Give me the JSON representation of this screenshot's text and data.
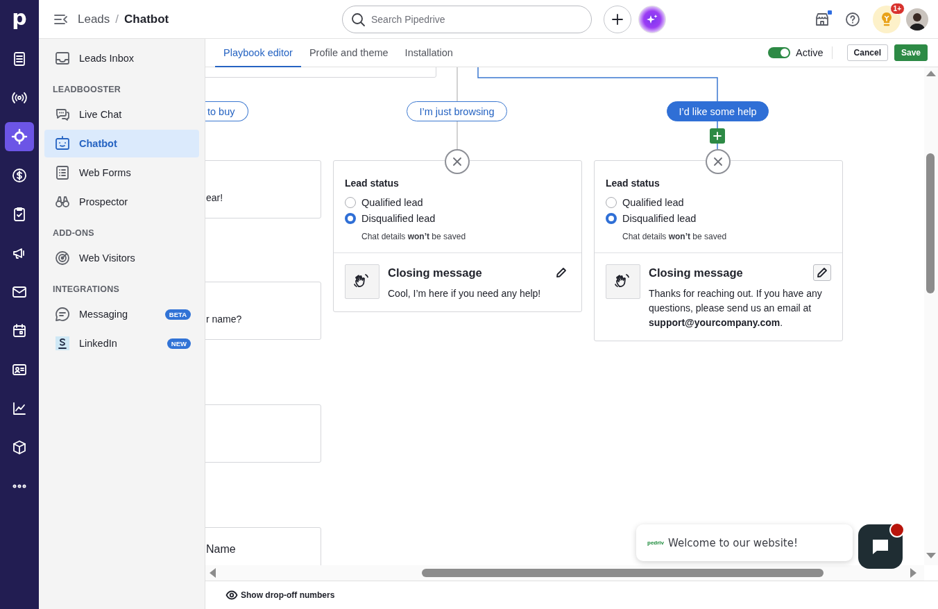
{
  "rail": {
    "logo": "p",
    "items": [
      {
        "selected": false
      },
      {
        "selected": false
      },
      {
        "selected": true
      },
      {
        "selected": false
      },
      {
        "selected": false
      },
      {
        "selected": false
      },
      {
        "selected": false
      },
      {
        "selected": false
      },
      {
        "selected": false
      },
      {
        "selected": false
      },
      {
        "selected": false
      },
      {
        "selected": false
      }
    ]
  },
  "header": {
    "breadcrumb_parent": "Leads",
    "separator": "/",
    "breadcrumb_current": "Chatbot",
    "search": {
      "placeholder": "Search Pipedrive"
    },
    "marketplace_dot": true,
    "tips_badge": "1+"
  },
  "sidebar": {
    "sections": [
      {
        "items": [
          {
            "label": "Leads Inbox",
            "selected": false
          }
        ]
      },
      {
        "heading": "LEADBOOSTER",
        "items": [
          {
            "label": "Live Chat",
            "selected": false
          },
          {
            "label": "Chatbot",
            "selected": true
          },
          {
            "label": "Web Forms",
            "selected": false
          },
          {
            "label": "Prospector",
            "selected": false
          }
        ]
      },
      {
        "heading": "ADD-ONS",
        "items": [
          {
            "label": "Web Visitors",
            "selected": false
          }
        ]
      },
      {
        "heading": "INTEGRATIONS",
        "items": [
          {
            "label": "Messaging",
            "selected": false,
            "badge": "BETA"
          },
          {
            "label": "LinkedIn",
            "selected": false,
            "badge": "NEW"
          }
        ]
      }
    ]
  },
  "tabs": [
    {
      "label": "Playbook editor",
      "selected": true
    },
    {
      "label": "Profile and theme",
      "selected": false
    },
    {
      "label": "Installation",
      "selected": false
    }
  ],
  "status_toggle": {
    "label": "Active",
    "on": true
  },
  "buttons": [
    {
      "label": "Cancel",
      "kind": "secondary"
    },
    {
      "label": "Save",
      "kind": "primary"
    }
  ],
  "canvas": {
    "answers": [
      {
        "label": "to buy",
        "selected": false
      },
      {
        "label": "I’m just browsing",
        "selected": false
      },
      {
        "label": "I’d like some help",
        "selected": true
      }
    ],
    "partial_cards": [
      {
        "kind": "text",
        "text": "ear!"
      },
      {
        "kind": "text",
        "text": "r name?"
      },
      {
        "kind": "empty"
      },
      {
        "kind": "title",
        "title": "Name"
      }
    ],
    "end_cards": [
      {
        "lead_status_title": "Lead status",
        "options": [
          {
            "label": "Qualified lead",
            "selected": false
          },
          {
            "label": "Disqualified lead",
            "selected": true
          }
        ],
        "note": "Chat details **won’t** be saved",
        "closing_title": "Closing message",
        "closing_message": "Cool, I’m here if you need any help!",
        "edit_focused": false
      },
      {
        "lead_status_title": "Lead status",
        "options": [
          {
            "label": "Qualified lead",
            "selected": false
          },
          {
            "label": "Disqualified lead",
            "selected": true
          }
        ],
        "note": "Chat details **won’t** be saved",
        "closing_title": "Closing message",
        "closing_message": "Thanks for reaching out. If you have any questions, please send us an email at **support@yourcompany.com**.",
        "edit_focused": true
      }
    ]
  },
  "chat_widget": {
    "logo_text": "pedriv",
    "message": "Welcome to our website!",
    "unread": true
  },
  "footer": {
    "drop_off_label": "Show drop-off numbers"
  }
}
